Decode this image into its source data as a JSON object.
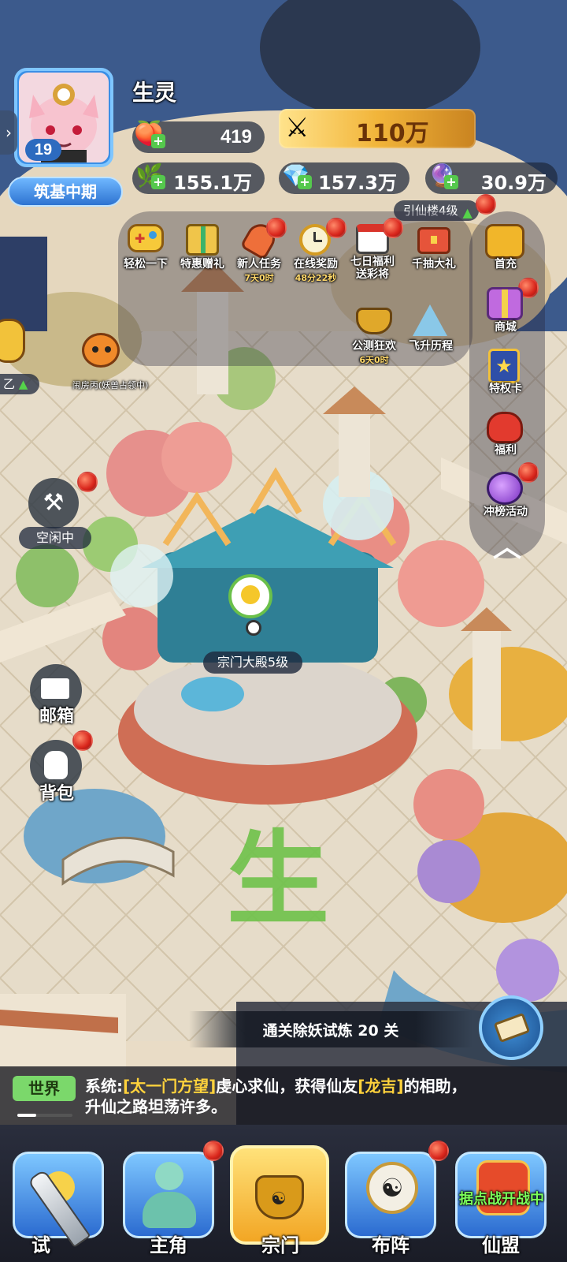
{
  "player": {
    "name": "生灵",
    "level": "19",
    "realm": "筑基中期"
  },
  "resources": {
    "energy": "419",
    "power": "110万",
    "herb": "155.1万",
    "spirit_stone": "157.3万",
    "special": "30.9万"
  },
  "top_icons": [
    {
      "label": "轻松一下",
      "sub": ""
    },
    {
      "label": "特惠赠礼",
      "sub": ""
    },
    {
      "label": "新人任务",
      "sub": "7天0时"
    },
    {
      "label": "在线奖励",
      "sub": "48分22秒"
    },
    {
      "label": "七日福利\n送彩将",
      "sub": ""
    },
    {
      "label": "千抽大礼",
      "sub": ""
    }
  ],
  "event_icons": [
    {
      "label": "公测狂欢",
      "sub": "6天0时"
    },
    {
      "label": "飞升历程",
      "sub": ""
    }
  ],
  "right_icons": [
    {
      "label": "首充"
    },
    {
      "label": "商城"
    },
    {
      "label": "特权卡"
    },
    {
      "label": "福利"
    },
    {
      "label": "冲榜活动"
    }
  ],
  "map_labels": {
    "building_tower": "引仙楼4级",
    "main_hall": "宗门大殿5级",
    "room": "闹房丙(妖兽占领中)",
    "left_tag": "乙",
    "idle": "空闲中",
    "watermark": "生"
  },
  "left_buttons": {
    "mail": "邮箱",
    "bag": "背包"
  },
  "quest": {
    "text": "通关除妖试炼 20 关"
  },
  "chat": {
    "channel": "世界",
    "prefix": "系统:",
    "name1": "[太一门方望]",
    "mid": "虔心求仙，获得仙友",
    "name2": "[龙吉]",
    "tail": "的相助，",
    "line2": "升仙之路坦荡许多。"
  },
  "bottom_nav": [
    {
      "label": "试"
    },
    {
      "label": "主角"
    },
    {
      "label": "宗门"
    },
    {
      "label": "布阵"
    },
    {
      "label": "仙盟",
      "badge": "据点战开战中"
    }
  ],
  "colors": {
    "accent_gold": "#f2b53a",
    "badge_green": "#7bd86b",
    "chat_highlight": "#ffd23c",
    "red_dot": "#d9261c"
  }
}
